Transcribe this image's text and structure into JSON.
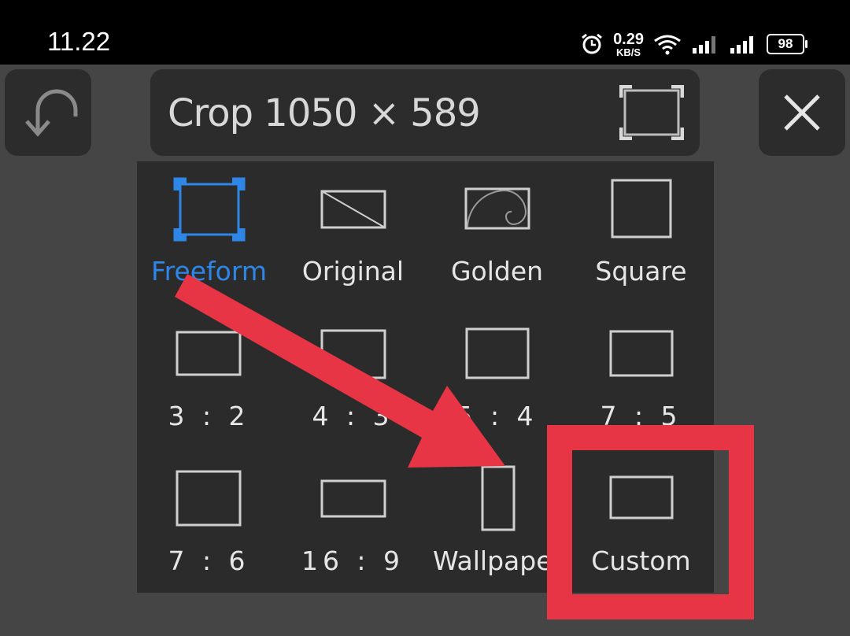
{
  "status_bar": {
    "time": "11.22",
    "net_speed_value": "0.29",
    "net_speed_unit": "KB/S",
    "battery": "98"
  },
  "toolbar": {
    "crop_title": "Crop 1050 × 589"
  },
  "crop_options": [
    {
      "label": "Freeform",
      "icon": "freeform-frame-icon",
      "selected": true
    },
    {
      "label": "Original",
      "icon": "original-ratio-icon"
    },
    {
      "label": "Golden",
      "icon": "golden-ratio-icon"
    },
    {
      "label": "Square",
      "icon": "square-ratio-icon"
    },
    {
      "label": "3 : 2",
      "icon": "ratio-3-2-icon"
    },
    {
      "label": "4 : 3",
      "icon": "ratio-4-3-icon"
    },
    {
      "label": "5 : 4",
      "icon": "ratio-5-4-icon"
    },
    {
      "label": "7 : 5",
      "icon": "ratio-7-5-icon"
    },
    {
      "label": "7 : 6",
      "icon": "ratio-7-6-icon"
    },
    {
      "label": "16 : 9",
      "icon": "ratio-16-9-icon"
    },
    {
      "label": "Wallpaper",
      "icon": "wallpaper-ratio-icon"
    },
    {
      "label": "Custom",
      "icon": "custom-ratio-icon"
    }
  ],
  "colors": {
    "accent": "#2e86e8",
    "annotation": "#e83545",
    "panel": "#2b2b2b",
    "background": "#454545"
  }
}
